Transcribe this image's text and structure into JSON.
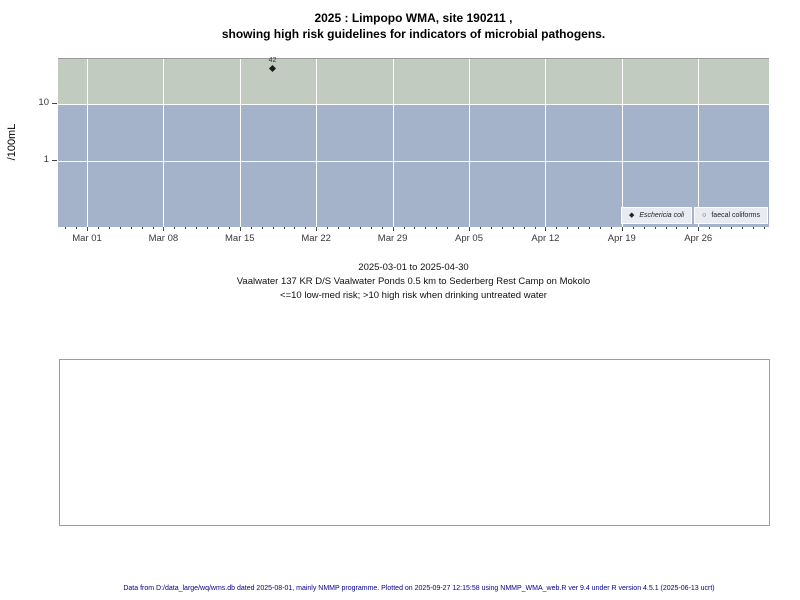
{
  "title": {
    "line1": "2025 : Limpopo WMA, site 190211 ,",
    "line2": "showing high risk guidelines for indicators of microbial pathogens."
  },
  "chart_data": {
    "type": "scatter",
    "title": "2025 : Limpopo WMA, site 190211 , showing high risk guidelines for indicators of microbial pathogens.",
    "ylabel": "/100mL",
    "y_scale": "log10",
    "y_ticks": [
      10,
      1
    ],
    "ylim_approx": [
      0.07,
      61
    ],
    "x_epoch": "2025-03-01",
    "x_range": [
      "2025-02-26",
      "2025-05-02"
    ],
    "x_major_ticks": [
      "Mar 01",
      "Mar 08",
      "Mar 15",
      "Mar 22",
      "Mar 29",
      "Apr 05",
      "Apr 12",
      "Apr 19",
      "Apr 26"
    ],
    "x_minor_tick_interval_days": 1,
    "grid": "white-on-bands",
    "legend_position": "bottom-right-inside",
    "bands": [
      {
        "name": "high-risk-band",
        "label": ">10 high risk",
        "from": 10,
        "to": null,
        "color": "#c2cbc0"
      },
      {
        "name": "low-med-risk-band",
        "label": "<=10 low-med risk",
        "from": null,
        "to": 10,
        "color": "#a4b2ca"
      }
    ],
    "series": [
      {
        "name": "Eschericia coli",
        "symbol": "filled-diamond",
        "points": [
          {
            "date": "2025-03-18",
            "value": 42,
            "label": "42"
          }
        ]
      },
      {
        "name": "faecal coliforms",
        "symbol": "open-circle",
        "points": []
      }
    ]
  },
  "legend": {
    "entries": [
      {
        "symbol": "filled-diamond",
        "label": "Eschericia coli",
        "italic": true
      },
      {
        "symbol": "open-circle",
        "label": "faecal coliforms",
        "italic": false
      }
    ]
  },
  "caption": {
    "line1": "2025-03-01 to 2025-04-30",
    "line2": "Vaalwater 137 KR D/S Vaalwater Ponds 0.5 km to Sederberg Rest Camp on Mokolo",
    "line3": "<=10 low-med risk; >10 high risk when drinking untreated water"
  },
  "footer": {
    "text": "Data from D:/data_large/wq/wms.db dated 2025-08-01, mainly NMMP programme. Plotted on 2025-09-27 12:15:58 using NMMP_WMA_web.R ver 9.4 under R version 4.5.1 (2025-06-13 ucrt)"
  }
}
